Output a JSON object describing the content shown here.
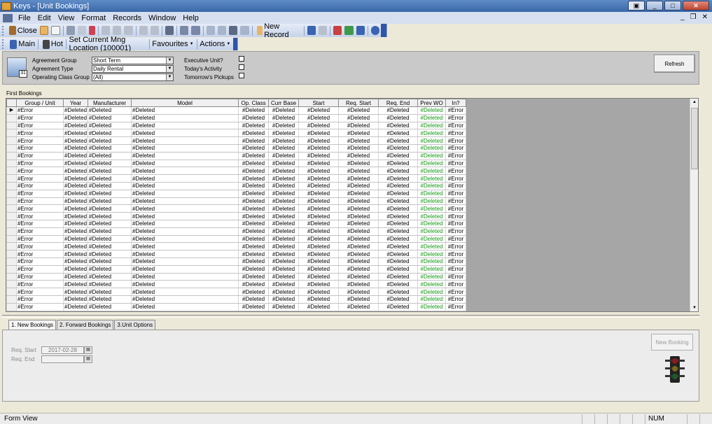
{
  "window": {
    "title": "Keys - [Unit Bookings]"
  },
  "menu": [
    "File",
    "Edit",
    "View",
    "Format",
    "Records",
    "Window",
    "Help"
  ],
  "toolbar": {
    "close_label": "Close",
    "new_record_label": "New Record"
  },
  "toolbar2": {
    "main": "Main",
    "hot": "Hot",
    "set_location": "Set Current Mng Location (100001)",
    "favourites": "Favourites",
    "actions": "Actions"
  },
  "filters": {
    "agreement_group_label": "Agreement Group",
    "agreement_group_value": "Short Term",
    "agreement_type_label": "Agreement Type",
    "agreement_type_value": "Daily Rental",
    "operating_class_label": "Operating Class Group",
    "operating_class_value": "(All)",
    "executive_unit_label": "Executive Unit?",
    "todays_activity_label": "Today's Activity",
    "tomorrows_pickups_label": "Tomorrow's Pickups",
    "calendar_day": "31",
    "refresh_label": "Refresh"
  },
  "grid": {
    "section_title": "First Bookings",
    "columns": [
      "Group / Unit",
      "Year",
      "Manufacturer",
      "Model",
      "Op. Class",
      "Curr Base",
      "Start",
      "Req. Start",
      "Req. End",
      "Prev WO",
      "In?"
    ],
    "row_values": [
      "#Error",
      "#Deleted",
      "#Deleted",
      "#Deleted",
      "#Deleted",
      "#Deleted",
      "#Deleted",
      "#Deleted",
      "#Deleted",
      "#Deleted",
      "#Error"
    ],
    "row_count": 27,
    "prev_wo_color": "#149a14"
  },
  "tabs": [
    "1. New Bookings",
    "2. Forward Bookings",
    "3.Unit Options"
  ],
  "new_bookings": {
    "req_start_label": "Req. Start",
    "req_start_value": "2017-02-28",
    "req_end_label": "Req. End",
    "req_end_value": "",
    "new_booking_label": "New Booking"
  },
  "statusbar": {
    "text": "Form View",
    "num": "NUM"
  }
}
